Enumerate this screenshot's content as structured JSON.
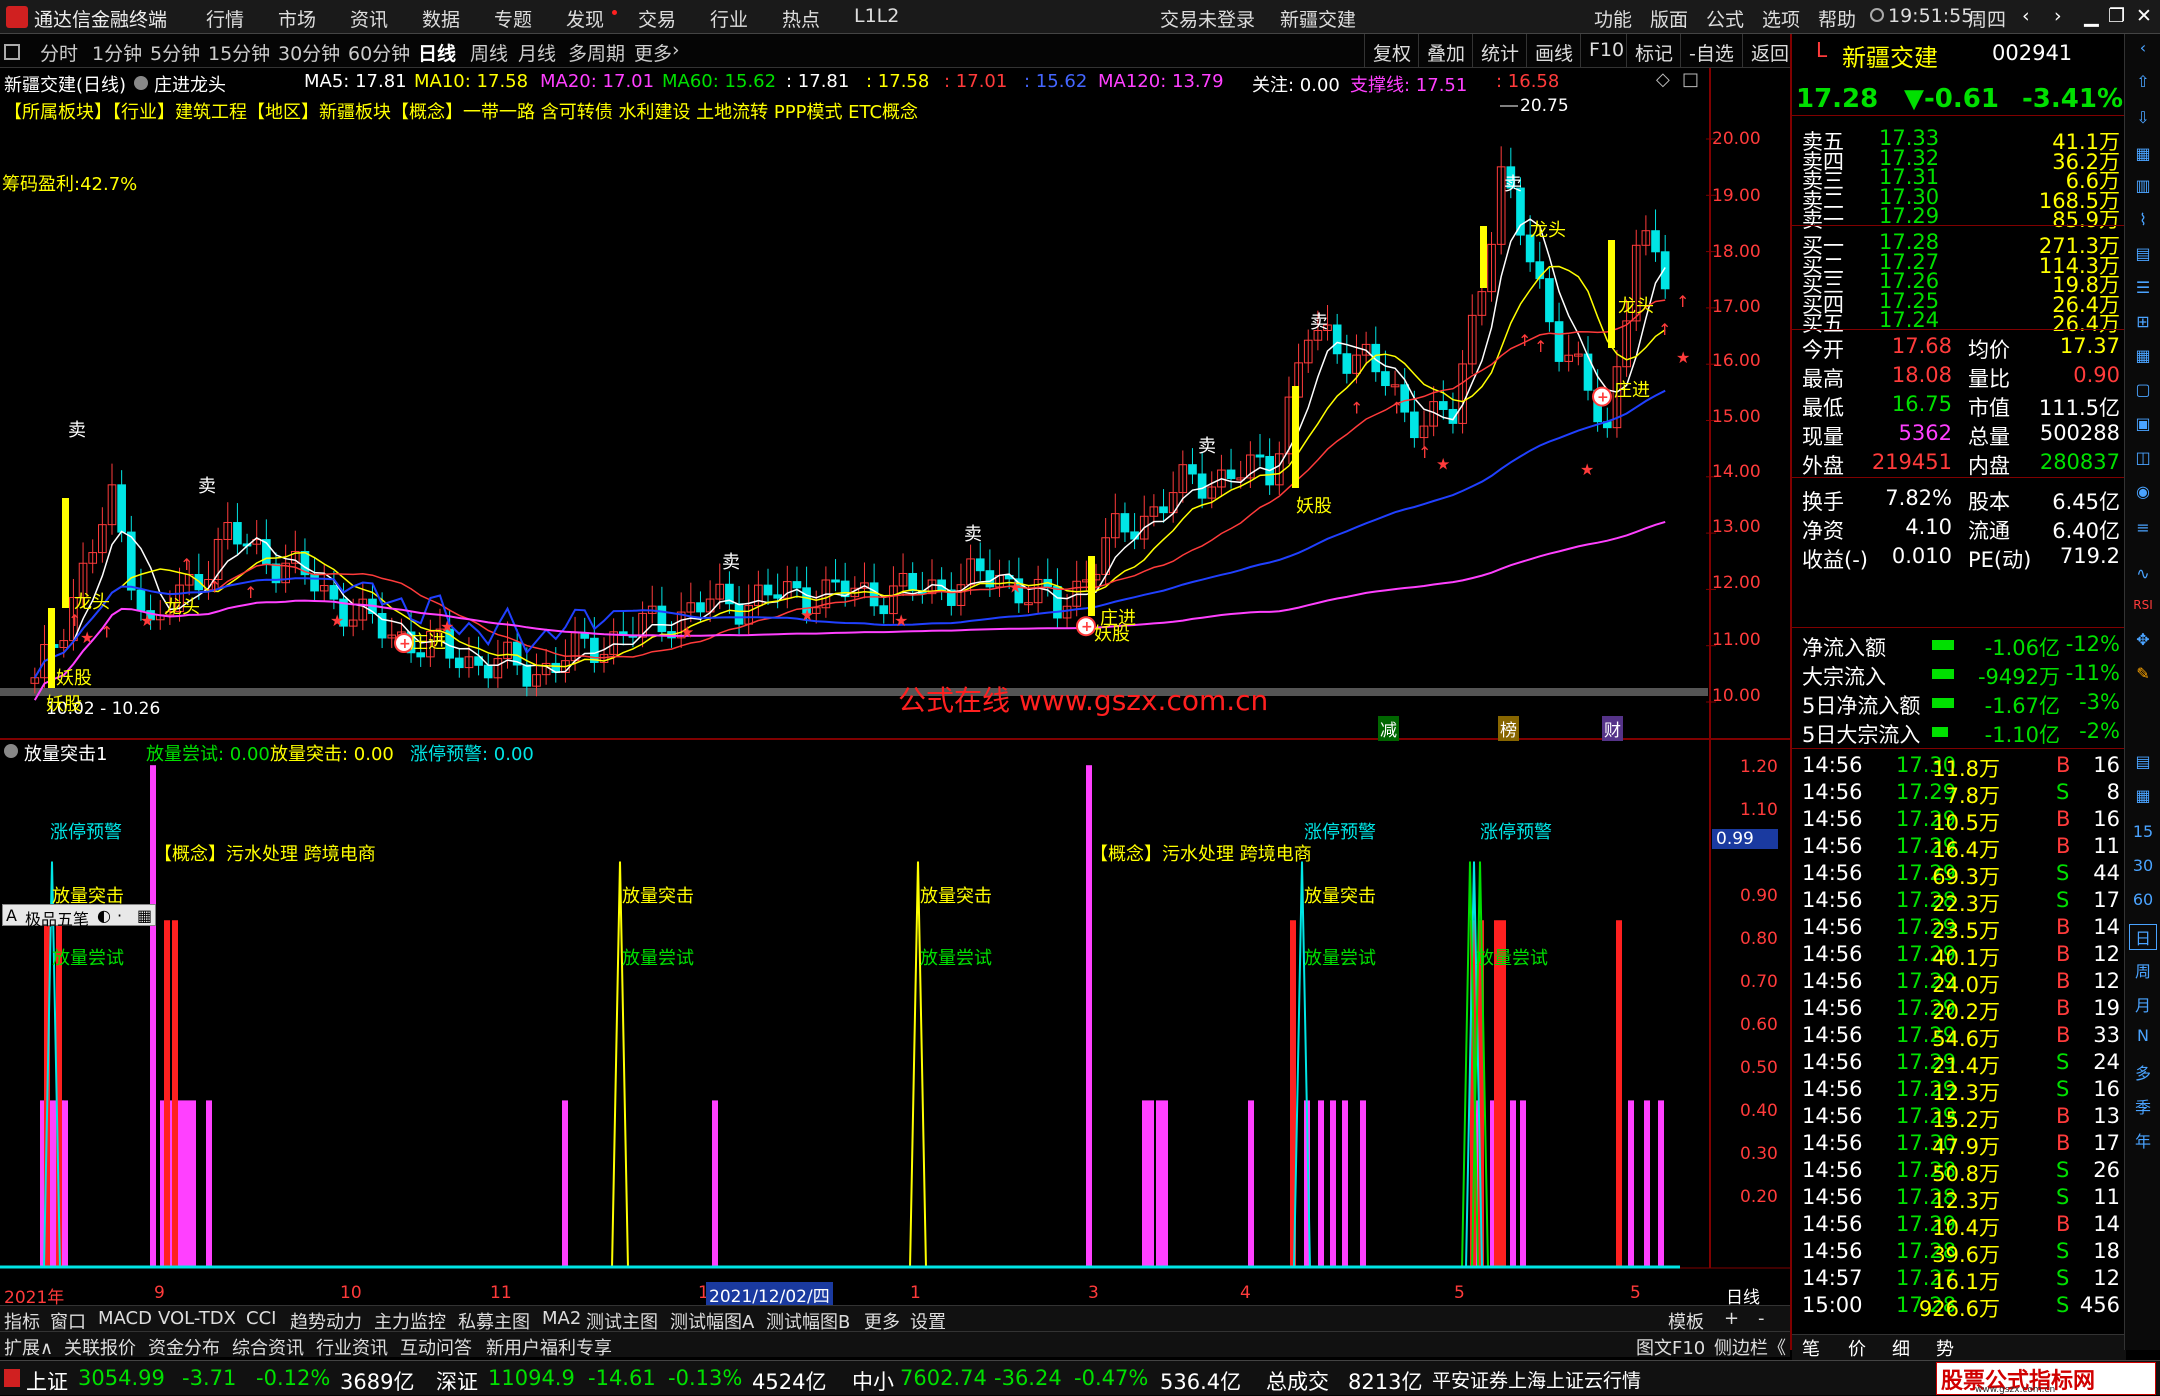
{
  "app": {
    "title": "通达信金融终端",
    "trade_status": "交易未登录",
    "stock_link": "新疆交建",
    "clock": "19:51:55",
    "weekday": "周四"
  },
  "menu": [
    "行情",
    "市场",
    "资讯",
    "数据",
    "专题",
    "发现",
    "交易",
    "行业",
    "热点",
    "L1L2",
    "功能",
    "版面",
    "公式",
    "选项",
    "帮助"
  ],
  "periods": [
    "分时",
    "1分钟",
    "5分钟",
    "15分钟",
    "30分钟",
    "60分钟",
    "日线",
    "周线",
    "月线",
    "多周期",
    "更多"
  ],
  "right_tools": [
    "复权",
    "叠加",
    "统计",
    "画线",
    "F10",
    "标记",
    "-自选",
    "返回"
  ],
  "chart_header": {
    "name": "新疆交建(日线)",
    "strategy": "庄进龙头",
    "ma5": "MA5: 17.81",
    "ma10": "MA10: 17.58",
    "ma20": "MA20: 17.01",
    "ma60": "MA60: 15.62",
    "ma_a": ": 17.81",
    "ma_b": ": 17.58",
    "ma_c": ": 17.01",
    "ma_d": ": 15.62",
    "ma120": "MA120: 13.79",
    "focus": "关注: 0.00",
    "support": "支撑线: 17.51",
    "support_b": ": 16.58"
  },
  "concept_line": "【所属板块】【行业】建筑工程【地区】新疆板块【概念】一带一路 含可转债 水利建设 土地流转 PPP模式 ETC概念",
  "chip_profit": "筹码盈利:42.7%",
  "watermark": "公式在线 www.gszx.com.cn",
  "price_axis": [
    "20.00",
    "19.00",
    "18.00",
    "17.00",
    "16.00",
    "15.00",
    "14.00",
    "13.00",
    "12.00",
    "11.00",
    "10.00"
  ],
  "price_marks": {
    "high": "20.75",
    "low": "10.02 - 10.26"
  },
  "chart_labels": {
    "sell": "卖",
    "dragon": "龙头",
    "monster": "妖股",
    "zhuangjin": "庄进"
  },
  "event_flags": [
    "减",
    "榜",
    "财"
  ],
  "indicator_header": {
    "name": "放量突击1",
    "try": "放量尝试: 0.00",
    "attack": "放量突击: 0.00",
    "limit": "涨停预警: 0.00"
  },
  "ind_axis": [
    "1.20",
    "1.10",
    "1.00",
    "0.90",
    "0.80",
    "0.70",
    "0.60",
    "0.50",
    "0.40",
    "0.30",
    "0.20"
  ],
  "ind_current": "0.99",
  "ind_labels": {
    "limit_warn": "涨停预警",
    "attack": "放量突击",
    "try": "放量尝试",
    "concept2": "【概念】污水处理 跨境电商"
  },
  "ime": "极品五笔",
  "date_axis": {
    "year": "2021年",
    "months": [
      "9",
      "10",
      "11",
      "1",
      "1",
      "3",
      "4",
      "5"
    ],
    "cursor": "2021/12/02/四",
    "period": "日线"
  },
  "bottom_tabs": [
    "指标",
    "窗口",
    "MACD",
    "VOL-TDX",
    "CCI",
    "趋势动力",
    "主力监控",
    "私募主图",
    "MA2",
    "测试主图",
    "测试幅图A",
    "测试幅图B",
    "更多",
    "设置",
    "模板",
    "+",
    "-"
  ],
  "bottom_tabs2": [
    "扩展∧",
    "关联报价",
    "资金分布",
    "综合资讯",
    "行业资讯",
    "互动问答",
    "新用户福利专享"
  ],
  "right_bottom_tabs": [
    "图文F10",
    "侧边栏《",
    "笔",
    "价",
    "细",
    "势"
  ],
  "quote": {
    "name": "新疆交建",
    "code": "002941",
    "price": "17.28",
    "change": "▼-0.61",
    "pct": "-3.41%",
    "asks": [
      [
        "卖五",
        "17.33",
        "41.1万"
      ],
      [
        "卖四",
        "17.32",
        "36.2万"
      ],
      [
        "卖三",
        "17.31",
        "6.6万"
      ],
      [
        "卖二",
        "17.30",
        "168.5万"
      ],
      [
        "卖一",
        "17.29",
        "85.9万"
      ]
    ],
    "bids": [
      [
        "买一",
        "17.28",
        "271.3万"
      ],
      [
        "买二",
        "17.27",
        "114.3万"
      ],
      [
        "买三",
        "17.26",
        "19.8万"
      ],
      [
        "买四",
        "17.25",
        "26.4万"
      ],
      [
        "买五",
        "17.24",
        "26.4万"
      ]
    ],
    "stats": [
      [
        "今开",
        "17.68",
        "均价",
        "17.37"
      ],
      [
        "最高",
        "18.08",
        "量比",
        "0.90"
      ],
      [
        "最低",
        "16.75",
        "市值",
        "111.5亿"
      ],
      [
        "现量",
        "5362",
        "总量",
        "500288"
      ],
      [
        "外盘",
        "219451",
        "内盘",
        "280837"
      ]
    ],
    "stats2": [
      [
        "换手",
        "7.82%",
        "股本",
        "6.45亿"
      ],
      [
        "净资",
        "4.10",
        "流通",
        "6.40亿"
      ],
      [
        "收益(-)",
        "0.010",
        "PE(动)",
        "719.2"
      ]
    ],
    "flows": [
      [
        "净流入额",
        "-1.06亿",
        "-12%"
      ],
      [
        "大宗流入",
        "-9492万",
        "-11%"
      ],
      [
        "5日净流入额",
        "-1.67亿",
        "-3%"
      ],
      [
        "5日大宗流入",
        "-1.10亿",
        "-2%"
      ]
    ],
    "ticks": [
      [
        "14:56",
        "17.30",
        "11.8万",
        "B",
        "16"
      ],
      [
        "14:56",
        "17.29",
        "7.8万",
        "S",
        "8"
      ],
      [
        "14:56",
        "17.29",
        "10.5万",
        "B",
        "16"
      ],
      [
        "14:56",
        "17.29",
        "16.4万",
        "B",
        "11"
      ],
      [
        "14:56",
        "17.29",
        "69.3万",
        "S",
        "44"
      ],
      [
        "14:56",
        "17.28",
        "22.3万",
        "S",
        "17"
      ],
      [
        "14:56",
        "17.29",
        "23.5万",
        "B",
        "14"
      ],
      [
        "14:56",
        "17.29",
        "40.1万",
        "B",
        "12"
      ],
      [
        "14:56",
        "17.29",
        "24.0万",
        "B",
        "12"
      ],
      [
        "14:56",
        "17.29",
        "20.2万",
        "B",
        "19"
      ],
      [
        "14:56",
        "17.29",
        "54.6万",
        "B",
        "33"
      ],
      [
        "14:56",
        "17.29",
        "21.4万",
        "S",
        "24"
      ],
      [
        "14:56",
        "17.29",
        "12.3万",
        "S",
        "16"
      ],
      [
        "14:56",
        "17.29",
        "15.2万",
        "B",
        "13"
      ],
      [
        "14:56",
        "17.30",
        "47.9万",
        "B",
        "17"
      ],
      [
        "14:56",
        "17.28",
        "50.8万",
        "S",
        "26"
      ],
      [
        "14:56",
        "17.28",
        "12.3万",
        "S",
        "11"
      ],
      [
        "14:56",
        "17.29",
        "10.4万",
        "B",
        "14"
      ],
      [
        "14:56",
        "17.28",
        "39.6万",
        "S",
        "18"
      ],
      [
        "14:57",
        "17.27",
        "16.1万",
        "S",
        "12"
      ],
      [
        "15:00",
        "17.28",
        "926.6万",
        "S",
        "456"
      ]
    ]
  },
  "side_icons": [
    "15",
    "30",
    "60",
    "日",
    "周",
    "月",
    "N",
    "多",
    "季",
    "年"
  ],
  "status": {
    "sh_label": "上证",
    "sh": "3054.99",
    "sh_chg": "-3.71",
    "sh_pct": "-0.12%",
    "sh_amt": "3689亿",
    "sz_label": "深证",
    "sz": "11094.9",
    "sz_chg": "-14.61",
    "sz_pct": "-0.13%",
    "sz_amt": "4524亿",
    "zx_label": "中小",
    "zx": "7602.74",
    "zx_chg": "-36.24",
    "zx_pct": "-0.47%",
    "zx_amt": "536.4亿",
    "total_label": "总成交",
    "total": "8213亿",
    "server": "平安证券上海上证云行情",
    "brand": "股票公式指标网",
    "brand_url": "www.gszx.com.cn"
  },
  "colors": {
    "up": "#ff3b3b",
    "down": "#00e5e5",
    "ma5": "#ffffff",
    "ma10": "#ffff00",
    "ma20": "#ff40ff",
    "ma60": "#00ff00",
    "ma120": "#ff40ff"
  }
}
